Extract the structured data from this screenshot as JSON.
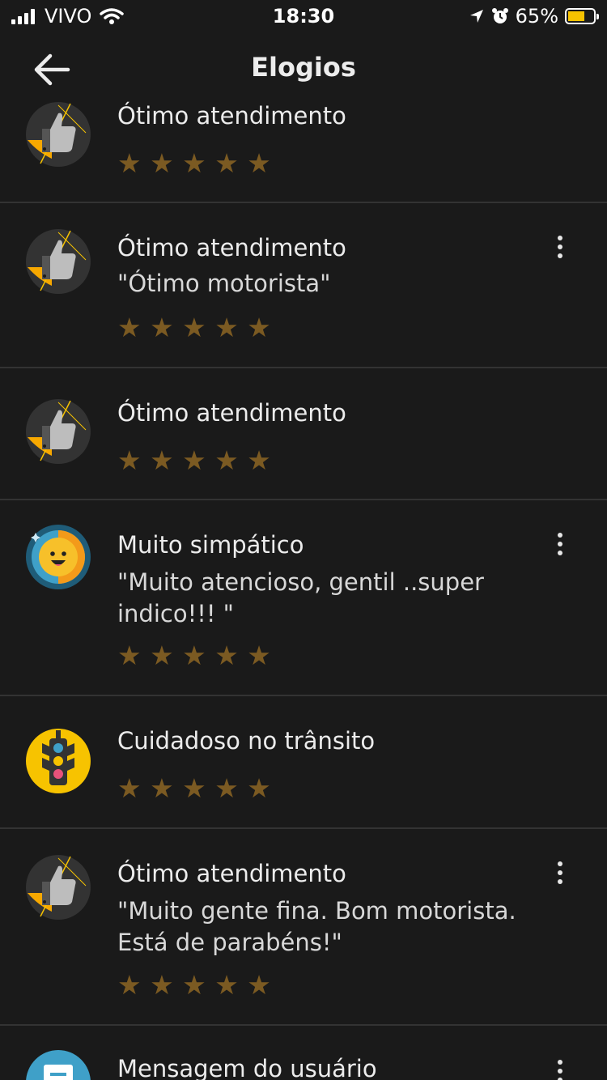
{
  "status_bar": {
    "carrier": "VIVO",
    "time": "18:30",
    "battery": "65%",
    "battery_level": 0.65
  },
  "header": {
    "title": "Elogios"
  },
  "items": [
    {
      "title": "Ótimo atendimento",
      "comment": "",
      "stars": "★ ★ ★ ★ ★",
      "badge": "thumbs-up-icon",
      "has_menu": false
    },
    {
      "title": "Ótimo atendimento",
      "comment": "\"Ótimo motorista\"",
      "stars": "★ ★ ★ ★ ★",
      "badge": "thumbs-up-icon",
      "has_menu": true
    },
    {
      "title": "Ótimo atendimento",
      "comment": "",
      "stars": "★ ★ ★ ★ ★",
      "badge": "thumbs-up-icon",
      "has_menu": false
    },
    {
      "title": "Muito simpático",
      "comment": "\"Muito atencioso, gentil ..super indico!!! \"",
      "stars": "★ ★ ★ ★ ★",
      "badge": "smiley-face-icon",
      "has_menu": true
    },
    {
      "title": "Cuidadoso no trânsito",
      "comment": "",
      "stars": "★ ★ ★ ★ ★",
      "badge": "traffic-light-icon",
      "has_menu": false
    },
    {
      "title": "Ótimo atendimento",
      "comment": "\"Muito gente fina. Bom motorista. Está de parabéns!\"",
      "stars": "★ ★ ★ ★ ★",
      "badge": "thumbs-up-icon",
      "has_menu": true
    },
    {
      "title": "Mensagem do usuário",
      "comment": "",
      "stars": "",
      "badge": "message-icon",
      "has_menu": true
    }
  ],
  "colors": {
    "background": "#1a1a1a",
    "star": "#7b5a22",
    "divider": "#333333",
    "accent_yellow": "#f7c300"
  }
}
